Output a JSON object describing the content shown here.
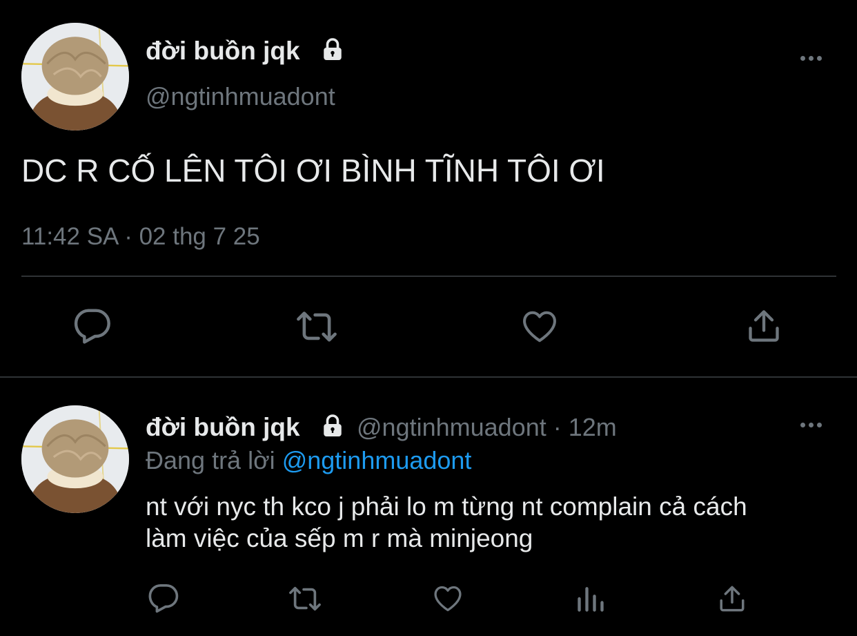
{
  "colors": {
    "background": "#000000",
    "text": "#e7e9ea",
    "muted": "#6e767d",
    "accent": "#1d9bf0",
    "divider": "#2f3336"
  },
  "main_tweet": {
    "display_name": "đời buồn jqk",
    "handle": "@ngtinhmuadont",
    "text": "DC R CỐ LÊN TÔI ƠI BÌNH TĨNH TÔI ƠI",
    "timestamp": "11:42 SA · 02 thg 7 25",
    "icons": [
      "lock-icon",
      "more-icon",
      "reply-icon",
      "retweet-icon",
      "like-icon",
      "share-icon"
    ]
  },
  "reply_tweet": {
    "display_name": "đời buồn jqk",
    "handle": "@ngtinhmuadont",
    "separator": "·",
    "time_ago": "12m",
    "replying_to_label": "Đang trả lời",
    "replying_to_handle": "@ngtinhmuadont",
    "text_line1": "nt với nyc th kco j phải lo m từng nt complain cả cách",
    "text_line2": "làm việc của sếp m r mà minjeong",
    "icons": [
      "lock-icon",
      "more-icon",
      "reply-icon",
      "retweet-icon",
      "like-icon",
      "analytics-icon",
      "share-icon"
    ]
  }
}
